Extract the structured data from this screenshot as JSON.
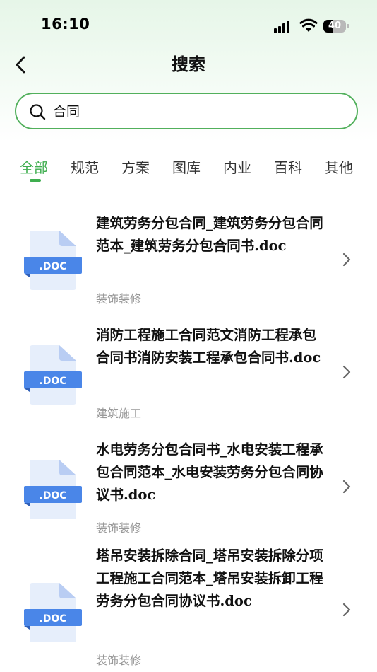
{
  "status_bar": {
    "time": "16:10",
    "battery": "40"
  },
  "header": {
    "title": "搜索"
  },
  "search": {
    "value": "合同",
    "placeholder": ""
  },
  "tabs": [
    {
      "label": "全部",
      "active": true
    },
    {
      "label": "规范",
      "active": false
    },
    {
      "label": "方案",
      "active": false
    },
    {
      "label": "图库",
      "active": false
    },
    {
      "label": "内业",
      "active": false
    },
    {
      "label": "百科",
      "active": false
    },
    {
      "label": "其他",
      "active": false
    }
  ],
  "results": [
    {
      "title": "建筑劳务分包合同_建筑劳务分包合同范本_建筑劳务分包合同书.doc",
      "category": "装饰装修",
      "file_type": ".DOC"
    },
    {
      "title": "消防工程施工合同范文消防工程承包合同书消防安装工程承包合同书.doc",
      "category": "建筑施工",
      "file_type": ".DOC"
    },
    {
      "title": "水电劳务分包合同书_水电安装工程承包合同范本_水电安装劳务分包合同协议书.doc",
      "category": "装饰装修",
      "file_type": ".DOC"
    },
    {
      "title": "塔吊安装拆除合同_塔吊安装拆除分项工程施工合同范本_塔吊安装拆卸工程劳务分包合同协议书.doc",
      "category": "装饰装修",
      "file_type": ".DOC"
    }
  ],
  "colors": {
    "accent": "#3fae4f",
    "doc_icon_blue": "#4a86e8",
    "doc_icon_page": "#e6eefb"
  },
  "icons": {
    "back": "chevron-left-icon",
    "search": "search-icon",
    "result_arrow": "chevron-right-icon",
    "result_file": "doc-file-icon"
  }
}
